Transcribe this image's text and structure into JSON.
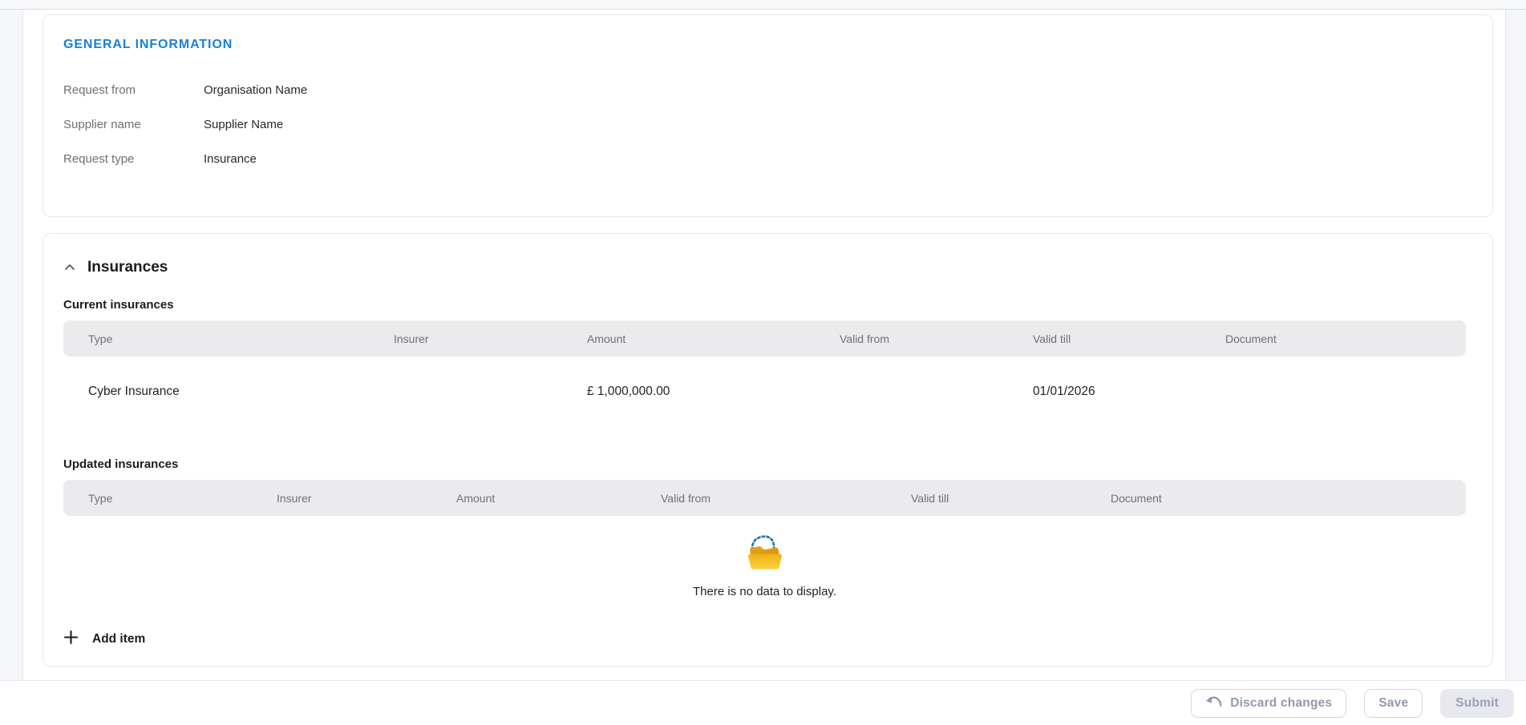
{
  "general_info": {
    "title": "GENERAL INFORMATION",
    "fields": [
      {
        "label": "Request from",
        "value": "Organisation Name"
      },
      {
        "label": "Supplier name",
        "value": "Supplier Name"
      },
      {
        "label": "Request type",
        "value": "Insurance"
      }
    ]
  },
  "insurances": {
    "section_title": "Insurances",
    "current": {
      "title": "Current insurances",
      "columns": [
        "Type",
        "Insurer",
        "Amount",
        "Valid from",
        "Valid till",
        "Document"
      ],
      "rows": [
        {
          "cells": [
            "Cyber Insurance",
            "",
            "£ 1,000,000.00",
            "",
            "01/01/2026",
            ""
          ]
        }
      ]
    },
    "updated": {
      "title": "Updated insurances",
      "columns": [
        "Type",
        "Insurer",
        "Amount",
        "Valid from",
        "Valid till",
        "Document"
      ],
      "empty_text": "There is no data to display."
    },
    "add_item_label": "Add item"
  },
  "actions": {
    "discard_label": "Discard changes",
    "save_label": "Save",
    "submit_label": "Submit"
  },
  "colors": {
    "accent_blue": "#1a80d9",
    "table_header_bg": "#ebebed",
    "muted_button_text": "#9298ad",
    "folder_front_yellow": "#f6c024",
    "folder_back_amber": "#d9980f",
    "dotted_trail_blue": "#1477b8"
  },
  "icons": {
    "section_collapse": "chevron-up-icon",
    "add_item": "plus-icon",
    "discard": "undo-icon",
    "empty_state": "open-folder-icon"
  }
}
